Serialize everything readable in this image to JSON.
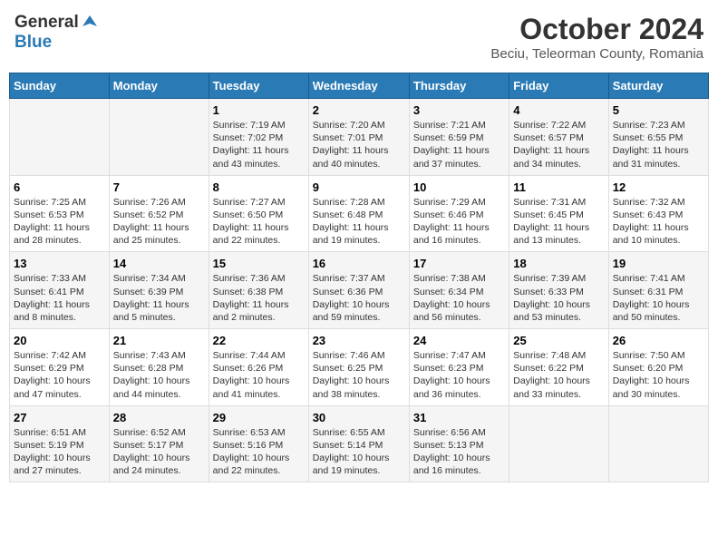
{
  "logo": {
    "general": "General",
    "blue": "Blue"
  },
  "title": "October 2024",
  "subtitle": "Beciu, Teleorman County, Romania",
  "days_of_week": [
    "Sunday",
    "Monday",
    "Tuesday",
    "Wednesday",
    "Thursday",
    "Friday",
    "Saturday"
  ],
  "weeks": [
    [
      {
        "day": "",
        "info": ""
      },
      {
        "day": "",
        "info": ""
      },
      {
        "day": "1",
        "info": "Sunrise: 7:19 AM\nSunset: 7:02 PM\nDaylight: 11 hours and 43 minutes."
      },
      {
        "day": "2",
        "info": "Sunrise: 7:20 AM\nSunset: 7:01 PM\nDaylight: 11 hours and 40 minutes."
      },
      {
        "day": "3",
        "info": "Sunrise: 7:21 AM\nSunset: 6:59 PM\nDaylight: 11 hours and 37 minutes."
      },
      {
        "day": "4",
        "info": "Sunrise: 7:22 AM\nSunset: 6:57 PM\nDaylight: 11 hours and 34 minutes."
      },
      {
        "day": "5",
        "info": "Sunrise: 7:23 AM\nSunset: 6:55 PM\nDaylight: 11 hours and 31 minutes."
      }
    ],
    [
      {
        "day": "6",
        "info": "Sunrise: 7:25 AM\nSunset: 6:53 PM\nDaylight: 11 hours and 28 minutes."
      },
      {
        "day": "7",
        "info": "Sunrise: 7:26 AM\nSunset: 6:52 PM\nDaylight: 11 hours and 25 minutes."
      },
      {
        "day": "8",
        "info": "Sunrise: 7:27 AM\nSunset: 6:50 PM\nDaylight: 11 hours and 22 minutes."
      },
      {
        "day": "9",
        "info": "Sunrise: 7:28 AM\nSunset: 6:48 PM\nDaylight: 11 hours and 19 minutes."
      },
      {
        "day": "10",
        "info": "Sunrise: 7:29 AM\nSunset: 6:46 PM\nDaylight: 11 hours and 16 minutes."
      },
      {
        "day": "11",
        "info": "Sunrise: 7:31 AM\nSunset: 6:45 PM\nDaylight: 11 hours and 13 minutes."
      },
      {
        "day": "12",
        "info": "Sunrise: 7:32 AM\nSunset: 6:43 PM\nDaylight: 11 hours and 10 minutes."
      }
    ],
    [
      {
        "day": "13",
        "info": "Sunrise: 7:33 AM\nSunset: 6:41 PM\nDaylight: 11 hours and 8 minutes."
      },
      {
        "day": "14",
        "info": "Sunrise: 7:34 AM\nSunset: 6:39 PM\nDaylight: 11 hours and 5 minutes."
      },
      {
        "day": "15",
        "info": "Sunrise: 7:36 AM\nSunset: 6:38 PM\nDaylight: 11 hours and 2 minutes."
      },
      {
        "day": "16",
        "info": "Sunrise: 7:37 AM\nSunset: 6:36 PM\nDaylight: 10 hours and 59 minutes."
      },
      {
        "day": "17",
        "info": "Sunrise: 7:38 AM\nSunset: 6:34 PM\nDaylight: 10 hours and 56 minutes."
      },
      {
        "day": "18",
        "info": "Sunrise: 7:39 AM\nSunset: 6:33 PM\nDaylight: 10 hours and 53 minutes."
      },
      {
        "day": "19",
        "info": "Sunrise: 7:41 AM\nSunset: 6:31 PM\nDaylight: 10 hours and 50 minutes."
      }
    ],
    [
      {
        "day": "20",
        "info": "Sunrise: 7:42 AM\nSunset: 6:29 PM\nDaylight: 10 hours and 47 minutes."
      },
      {
        "day": "21",
        "info": "Sunrise: 7:43 AM\nSunset: 6:28 PM\nDaylight: 10 hours and 44 minutes."
      },
      {
        "day": "22",
        "info": "Sunrise: 7:44 AM\nSunset: 6:26 PM\nDaylight: 10 hours and 41 minutes."
      },
      {
        "day": "23",
        "info": "Sunrise: 7:46 AM\nSunset: 6:25 PM\nDaylight: 10 hours and 38 minutes."
      },
      {
        "day": "24",
        "info": "Sunrise: 7:47 AM\nSunset: 6:23 PM\nDaylight: 10 hours and 36 minutes."
      },
      {
        "day": "25",
        "info": "Sunrise: 7:48 AM\nSunset: 6:22 PM\nDaylight: 10 hours and 33 minutes."
      },
      {
        "day": "26",
        "info": "Sunrise: 7:50 AM\nSunset: 6:20 PM\nDaylight: 10 hours and 30 minutes."
      }
    ],
    [
      {
        "day": "27",
        "info": "Sunrise: 6:51 AM\nSunset: 5:19 PM\nDaylight: 10 hours and 27 minutes."
      },
      {
        "day": "28",
        "info": "Sunrise: 6:52 AM\nSunset: 5:17 PM\nDaylight: 10 hours and 24 minutes."
      },
      {
        "day": "29",
        "info": "Sunrise: 6:53 AM\nSunset: 5:16 PM\nDaylight: 10 hours and 22 minutes."
      },
      {
        "day": "30",
        "info": "Sunrise: 6:55 AM\nSunset: 5:14 PM\nDaylight: 10 hours and 19 minutes."
      },
      {
        "day": "31",
        "info": "Sunrise: 6:56 AM\nSunset: 5:13 PM\nDaylight: 10 hours and 16 minutes."
      },
      {
        "day": "",
        "info": ""
      },
      {
        "day": "",
        "info": ""
      }
    ]
  ]
}
